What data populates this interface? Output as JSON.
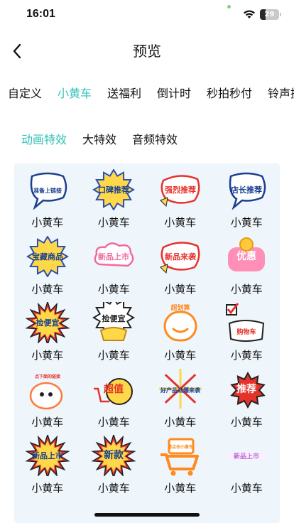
{
  "status_bar": {
    "time": "16:01",
    "battery": "29",
    "battery_level": 0.29
  },
  "header": {
    "title": "预览"
  },
  "category_tabs": [
    {
      "label": "自定义",
      "active": false
    },
    {
      "label": "小黄车",
      "active": true
    },
    {
      "label": "送福利",
      "active": false
    },
    {
      "label": "倒计时",
      "active": false
    },
    {
      "label": "秒拍秒付",
      "active": false
    },
    {
      "label": "铃声提",
      "active": false
    }
  ],
  "effect_tabs": [
    {
      "label": "动画特效",
      "active": true
    },
    {
      "label": "大特效",
      "active": false
    },
    {
      "label": "音频特效",
      "active": false
    }
  ],
  "accent_color": "#2fc2b8",
  "items": [
    {
      "label": "小黄车",
      "sticker": {
        "text": "准备上链接",
        "icon": "speech-bubble-sticker"
      }
    },
    {
      "label": "小黄车",
      "sticker": {
        "text": "口碑推荐",
        "icon": "star-badge-sticker"
      }
    },
    {
      "label": "小黄车",
      "sticker": {
        "text": "强烈推荐",
        "icon": "megaphone-sticker"
      }
    },
    {
      "label": "小黄车",
      "sticker": {
        "text": "店长推荐",
        "icon": "speech-bubble-sticker"
      }
    },
    {
      "label": "小黄车",
      "sticker": {
        "text": "宝藏商品",
        "icon": "star-badge-sticker"
      }
    },
    {
      "label": "小黄车",
      "sticker": {
        "text": "新品上市",
        "icon": "cloud-sticker"
      }
    },
    {
      "label": "小黄车",
      "sticker": {
        "text": "新品来袭",
        "icon": "megaphone-sticker"
      }
    },
    {
      "label": "小黄车",
      "sticker": {
        "text": "优惠",
        "icon": "coin-sticker"
      }
    },
    {
      "label": "小黄车",
      "sticker": {
        "text": "捡便宜",
        "icon": "burst-sticker"
      }
    },
    {
      "label": "小黄车",
      "sticker": {
        "text": "捡便宜",
        "icon": "gold-ingot-sticker"
      }
    },
    {
      "label": "小黄车",
      "sticker": {
        "text": "超划算",
        "icon": "smile-face-sticker"
      }
    },
    {
      "label": "小黄车",
      "sticker": {
        "text": "购物车",
        "icon": "checkbox-sticker"
      }
    },
    {
      "label": "小黄车",
      "sticker": {
        "text": "点下面的链接",
        "icon": "character-sticker"
      }
    },
    {
      "label": "小黄车",
      "sticker": {
        "text": "超值",
        "icon": "bee-cart-sticker"
      }
    },
    {
      "label": "小黄车",
      "sticker": {
        "text": "好产品劲爆来袭",
        "icon": "fireworks-sticker"
      }
    },
    {
      "label": "小黄车",
      "sticker": {
        "text": "推荐",
        "icon": "hand-sticker"
      }
    },
    {
      "label": "小黄车",
      "sticker": {
        "text": "新品上市",
        "icon": "burst-sticker"
      }
    },
    {
      "label": "小黄车",
      "sticker": {
        "text": "新款",
        "icon": "burst-sticker"
      }
    },
    {
      "label": "小黄车",
      "sticker": {
        "text": "请点击小黄车",
        "icon": "shopping-cart-sticker"
      }
    },
    {
      "label": "小黄车",
      "sticker": {
        "text": "新品上市",
        "icon": "text-line-sticker"
      }
    }
  ]
}
